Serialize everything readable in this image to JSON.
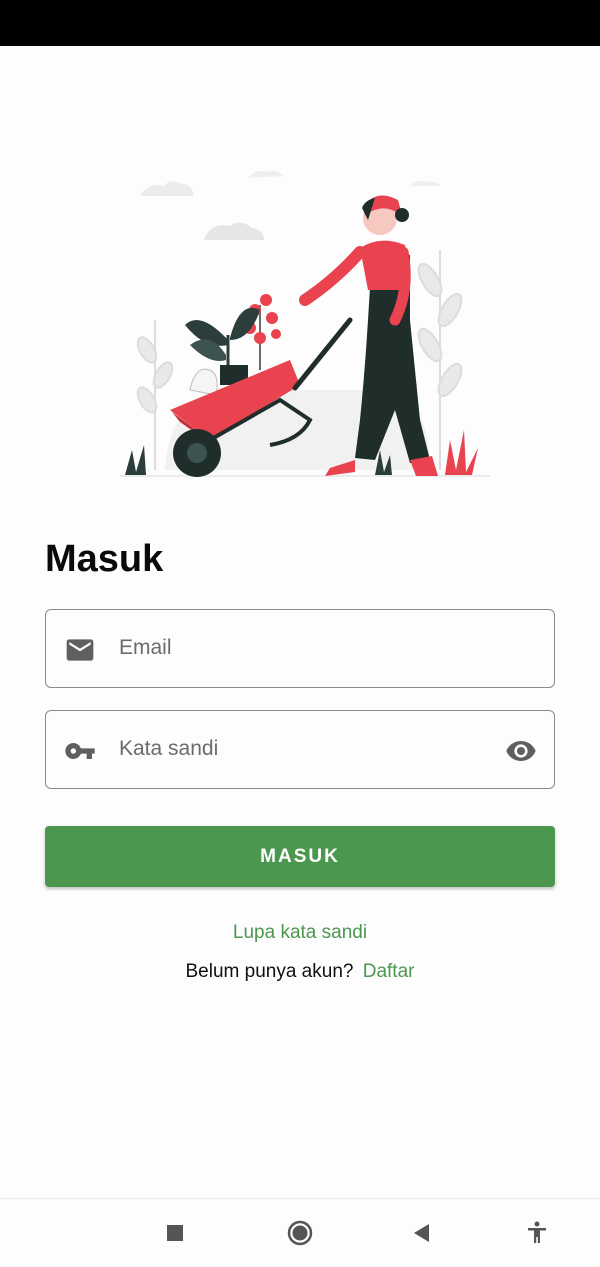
{
  "page": {
    "title": "Masuk"
  },
  "email_field": {
    "placeholder": "Email",
    "value": "",
    "icon": "email-icon"
  },
  "password_field": {
    "placeholder": "Kata sandi",
    "value": "",
    "icon": "key-icon",
    "toggle_icon": "eye-icon"
  },
  "login_button": {
    "label": "MASUK"
  },
  "forgot_link": {
    "label": "Lupa kata sandi"
  },
  "register": {
    "prompt": "Belum punya akun?",
    "link": "Daftar"
  },
  "colors": {
    "accent": "#4b974d",
    "illustration_red": "#e8434f",
    "illustration_dark": "#1f2d2b"
  },
  "navigation": {
    "items": [
      "square-icon",
      "circle-home-icon",
      "back-triangle-icon",
      "accessibility-icon"
    ]
  }
}
